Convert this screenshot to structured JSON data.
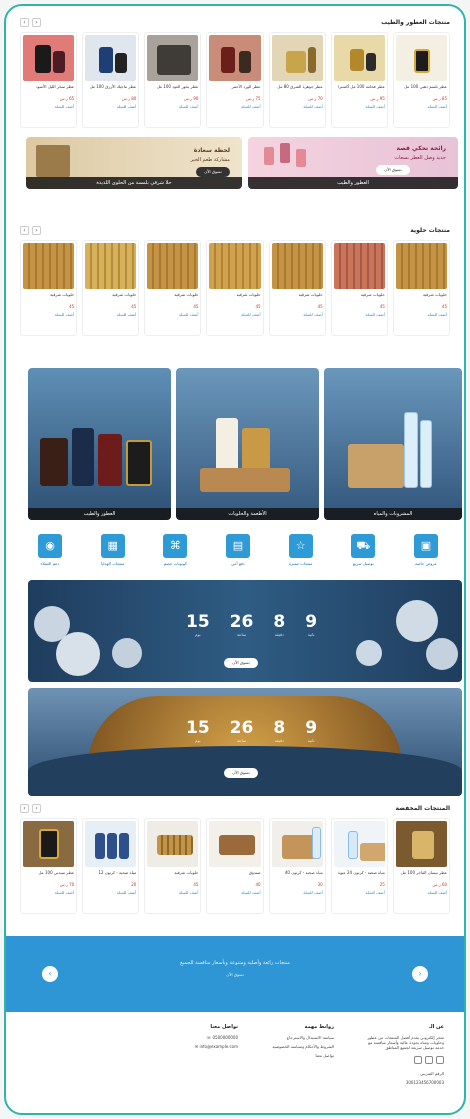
{
  "sections": {
    "perfumes": {
      "title": "منتجات العطور والطيب",
      "products": [
        {
          "name": "عطر بلسم ذهبي 100 مل",
          "price": "85 ر.س",
          "btn": "أضف للسلة"
        },
        {
          "name": "عطر فخامة 100 مل أكسترا",
          "price": "95 ر.س",
          "btn": "أضف للسلة"
        },
        {
          "name": "عطر جوهرة الشرق 80 مل",
          "price": "70 ر.س",
          "btn": "أضف للسلة"
        },
        {
          "name": "عطر الورد الأحمر",
          "price": "75 ر.س",
          "btn": "أضف للسلة"
        },
        {
          "name": "عطر بخور العود 100 مل",
          "price": "90 ر.س",
          "btn": "أضف للسلة"
        },
        {
          "name": "عطر ماجيك الأزرق 100 مل",
          "price": "80 ر.س",
          "btn": "أضف للسلة"
        },
        {
          "name": "عطر سحر الليل الأسود",
          "price": "65 ر.س",
          "btn": "أضف للسلة"
        }
      ]
    },
    "sweets": {
      "title": "منتجات حلوية",
      "products": [
        {
          "name": "حلويات شرقية",
          "price": "45",
          "btn": "أضف للسلة"
        },
        {
          "name": "حلويات شرقية",
          "price": "45",
          "btn": "أضف للسلة"
        },
        {
          "name": "حلويات شرقية",
          "price": "45",
          "btn": "أضف للسلة"
        },
        {
          "name": "حلويات شرقية",
          "price": "45",
          "btn": "أضف للسلة"
        },
        {
          "name": "حلويات شرقية",
          "price": "45",
          "btn": "أضف للسلة"
        },
        {
          "name": "حلويات شرقية",
          "price": "45",
          "btn": "أضف للسلة"
        },
        {
          "name": "حلويات شرقية",
          "price": "45",
          "btn": "أضف للسلة"
        }
      ]
    },
    "featured": {
      "title": "المنتجات المخفضة",
      "products": [
        {
          "name": "عطر نيسان الفاخر 100 مل",
          "price": "60 ر.س",
          "btn": "أضف للسلة"
        },
        {
          "name": "مياه صحية - كرتون 24 عبوة",
          "price": "25",
          "btn": "أضف للسلة"
        },
        {
          "name": "مياه صحية - كرتون 40",
          "price": "30",
          "btn": "أضف للسلة"
        },
        {
          "name": "صندوق",
          "price": "40",
          "btn": "أضف للسلة"
        },
        {
          "name": "حلويات شرقية",
          "price": "45",
          "btn": "أضف للسلة"
        },
        {
          "name": "مياه صحية - كرتون 12",
          "price": "20",
          "btn": "أضف للسلة"
        },
        {
          "name": "عطر سيدني 100 مل",
          "price": "70 ر.س",
          "btn": "أضف للسلة"
        }
      ]
    }
  },
  "promo_banners": {
    "left": {
      "line1": "لحظة سعادة",
      "line2": "مشاركة طعم الخير",
      "cta": "تسوق الآن",
      "caption": "حلا شرقي بلمسة من الحلوى اللذيذة"
    },
    "right": {
      "line1": "رائحة تحكي قصة",
      "line2": "جديد وصل العطر بسعات",
      "cta": "تسوق الآن",
      "caption": "العطور والطيب"
    }
  },
  "category_banners": [
    {
      "caption": "المشروبات والمياه"
    },
    {
      "caption": "الأطعمة والحلويات"
    },
    {
      "caption": "العطور والطيب"
    }
  ],
  "icon_categories": [
    {
      "label": "عروض خاصة",
      "icon": "box-icon"
    },
    {
      "label": "توصيل سريع",
      "icon": "truck-icon"
    },
    {
      "label": "منتجات مميزة",
      "icon": "star-icon"
    },
    {
      "label": "دفع آمن",
      "icon": "card-icon"
    },
    {
      "label": "كوبونات خصم",
      "icon": "tag-icon"
    },
    {
      "label": "منتجات الهدايا",
      "icon": "gift-icon"
    },
    {
      "label": "دعم العملاء",
      "icon": "support-icon"
    }
  ],
  "countdowns": [
    {
      "days": "15",
      "hours": "26",
      "minutes": "8",
      "seconds": "9",
      "days_l": "يوم",
      "hours_l": "ساعة",
      "minutes_l": "دقيقة",
      "seconds_l": "ثانية",
      "cta": "تسوق الآن"
    },
    {
      "days": "15",
      "hours": "26",
      "minutes": "8",
      "seconds": "9",
      "days_l": "يوم",
      "hours_l": "ساعة",
      "minutes_l": "دقيقة",
      "seconds_l": "ثانية",
      "cta": "تسوق الآن"
    }
  ],
  "blue_band": {
    "text": "منتجات رائعة وأصلية ومتنوعة وبأسعار منافسة للجميع",
    "sub": "تسوق الآن"
  },
  "footer": {
    "about": {
      "title": "عن الـ",
      "text": "متجر إلكتروني يقدم أفضل المنتجات من عطور وحلويات ومياه بجودة عالية وأسعار منافسة مع خدمة توصيل سريعة لجميع المناطق",
      "code": "الرقم الضريبي",
      "vat": "300123456700003"
    },
    "links": {
      "title": "روابط مهمة",
      "items": [
        "سياسة الاستبدال والاسترجاع",
        "الشروط والأحكام وسياسة الخصوصية",
        "تواصل معنا"
      ]
    },
    "contact": {
      "title": "تواصل معنا",
      "phone": "0500000000",
      "email": "info@example.com"
    }
  },
  "colors": {
    "accent": "#2f9bd6",
    "frame": "#2eb5a8",
    "price": "#c0392b"
  }
}
